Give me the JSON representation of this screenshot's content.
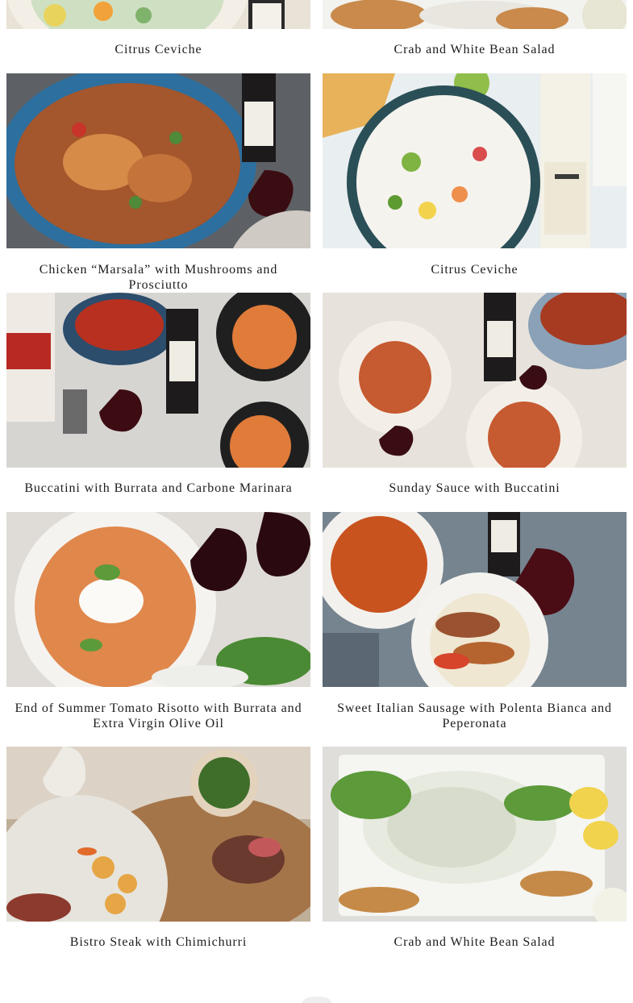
{
  "cards": [
    {
      "title": "Citrus Ceviche",
      "image_alt": "citrus-ceviche-photo"
    },
    {
      "title": "Crab and White Bean Salad",
      "image_alt": "crab-white-bean-salad-photo"
    },
    {
      "title": "Chicken “Marsala” with Mushrooms and Prosciutto",
      "image_alt": "chicken-marsala-photo"
    },
    {
      "title": "Citrus Ceviche",
      "image_alt": "citrus-ceviche-photo"
    },
    {
      "title": "Buccatini with Burrata and Carbone Marinara",
      "image_alt": "buccatini-burrata-photo"
    },
    {
      "title": "Sunday Sauce with Buccatini",
      "image_alt": "sunday-sauce-photo"
    },
    {
      "title": "End of Summer Tomato Risotto with Burrata and Extra Virgin Olive Oil",
      "image_alt": "tomato-risotto-photo"
    },
    {
      "title": "Sweet Italian Sausage with Polenta Bianca and Peperonata",
      "image_alt": "sausage-polenta-photo"
    },
    {
      "title": "Bistro Steak with Chimichurri",
      "image_alt": "bistro-steak-photo"
    },
    {
      "title": "Crab and White Bean Salad",
      "image_alt": "crab-white-bean-salad-photo"
    }
  ],
  "colors": {
    "background": "#ffffff",
    "text": "#1c1c1c"
  }
}
